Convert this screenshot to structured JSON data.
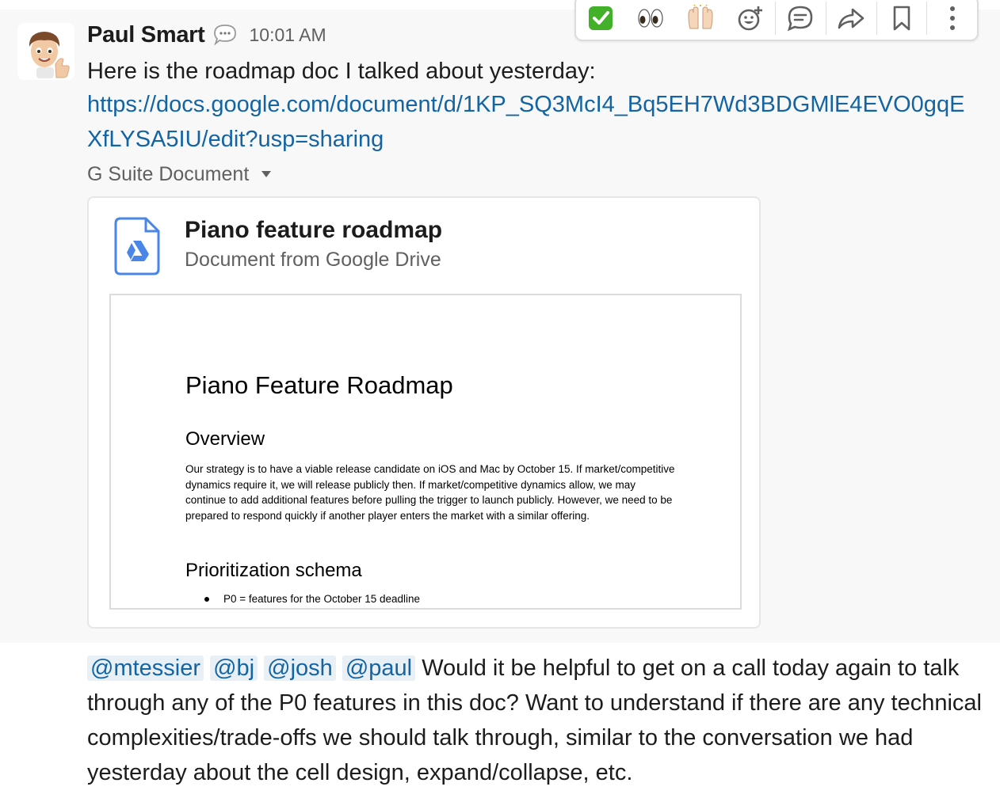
{
  "message": {
    "sender": "Paul Smart",
    "timestamp": "10:01 AM",
    "text": "Here is the roadmap doc I talked about yesterday:",
    "link": "https://docs.google.com/document/d/1KP_SQ3McI4_Bq5EH7Wd3BDGMlE4EVO0gqEXfLYSA5IU/edit?usp=sharing"
  },
  "attachment": {
    "label": "G Suite Document",
    "title": "Piano feature roadmap",
    "subtitle": "Document from Google Drive",
    "preview": {
      "heading": "Piano Feature Roadmap",
      "section1": "Overview",
      "paragraph": "Our strategy is to have a viable release candidate on iOS and Mac by October 15. If market/competitive dynamics require it, we will release publicly then. If market/competitive dynamics allow, we may continue to add additional features before pulling the trigger to launch publicly. However, we need to be prepared to respond quickly if another player enters the market with a similar offering.",
      "section2": "Prioritization schema",
      "bullet": "P0 = features for the October 15 deadline"
    }
  },
  "toolbar": {
    "items": [
      {
        "icon": "white-check-mark-icon",
        "glyph": "✅"
      },
      {
        "icon": "eyes-icon",
        "glyph": "👀"
      },
      {
        "icon": "raised-hands-icon",
        "glyph": "🙌"
      },
      {
        "icon": "add-reaction-icon"
      },
      {
        "icon": "reply-in-thread-icon"
      },
      {
        "icon": "share-icon"
      },
      {
        "icon": "bookmark-icon"
      },
      {
        "icon": "more-actions-icon"
      }
    ]
  },
  "followup": {
    "mentions": [
      "@mtessier",
      "@bj",
      "@josh",
      "@paul"
    ],
    "text": "Would it be helpful to get on a call today again to talk through any of the P0 features in this doc? Want to understand if there are any technical complexities/trade-offs we should talk through, similar to the conversation we had yesterday about the cell design, expand/collapse, etc."
  },
  "colors": {
    "link": "#1264a3",
    "mention_bg": "#e8f0f6",
    "muted_text": "#616061",
    "drive_blue": "#4a86e8"
  }
}
